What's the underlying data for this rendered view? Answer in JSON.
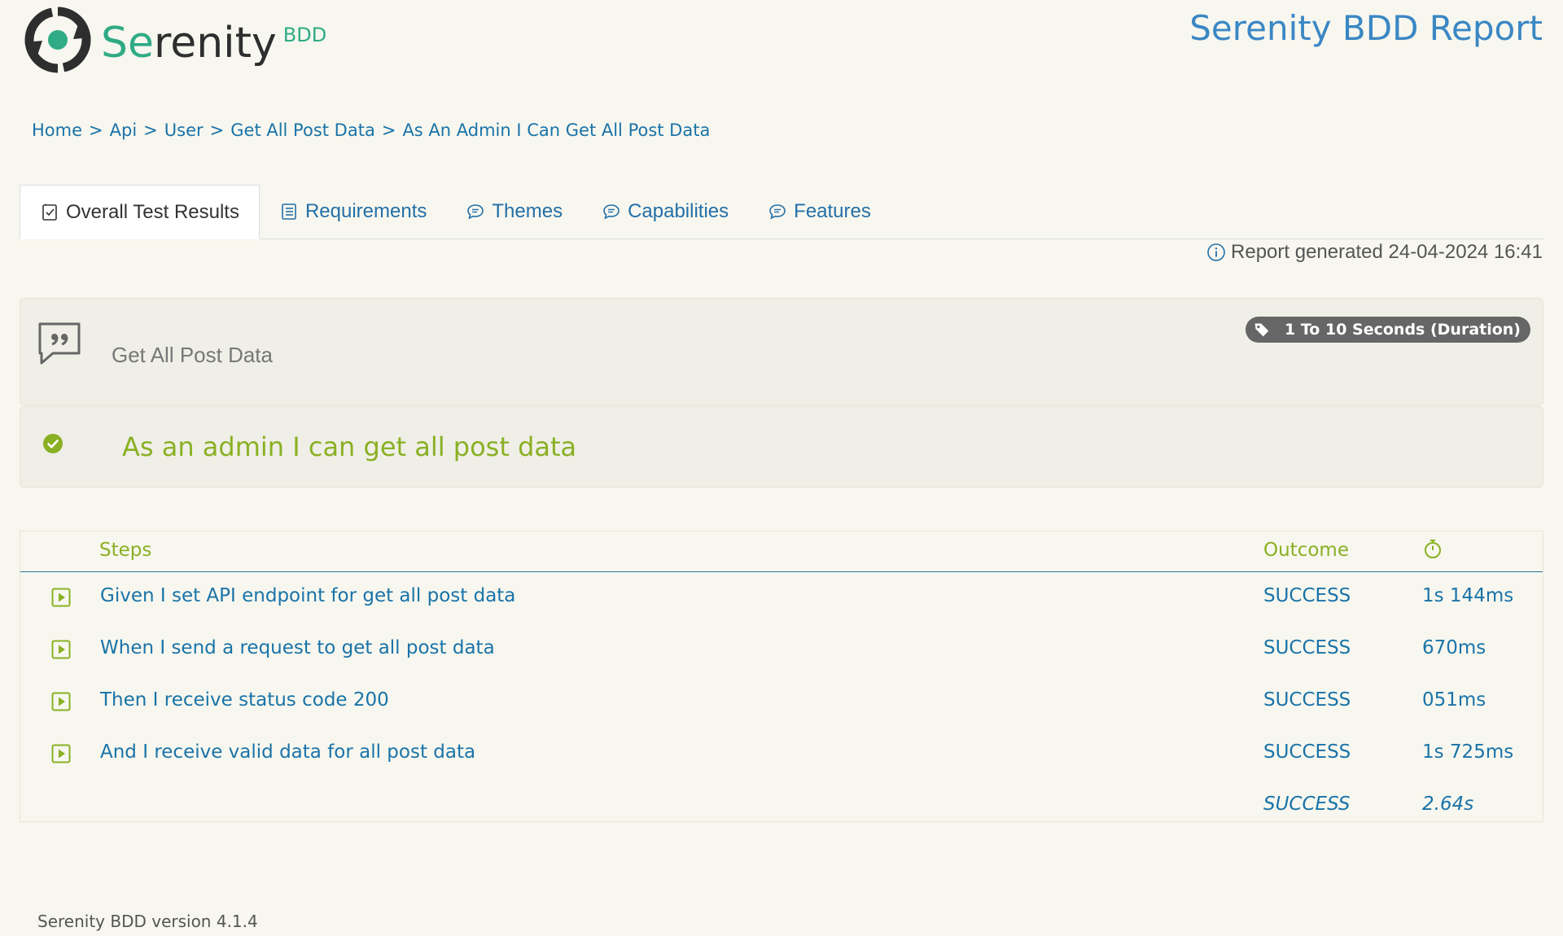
{
  "header": {
    "logo_word_prefix": "Se",
    "logo_word_rest": "renity",
    "logo_suffix": "BDD",
    "report_title": "Serenity BDD Report"
  },
  "breadcrumb": {
    "items": [
      "Home",
      "Api",
      "User",
      "Get All Post Data",
      "As An Admin I Can Get All Post Data"
    ],
    "separator": ">"
  },
  "tabs": [
    {
      "label": "Overall Test Results",
      "icon": "checklist-icon",
      "active": true
    },
    {
      "label": "Requirements",
      "icon": "list-icon",
      "active": false
    },
    {
      "label": "Themes",
      "icon": "comment-icon",
      "active": false
    },
    {
      "label": "Capabilities",
      "icon": "comment-icon",
      "active": false
    },
    {
      "label": "Features",
      "icon": "comment-icon",
      "active": false
    }
  ],
  "report_generated": "Report generated 24-04-2024 16:41",
  "feature": {
    "title": "Get All Post Data",
    "tag": "1 To 10 Seconds (Duration)"
  },
  "scenario": {
    "title": "As an admin I can get all post data",
    "status_icon": "check-circle-icon"
  },
  "steps_table": {
    "headers": {
      "steps": "Steps",
      "outcome": "Outcome",
      "time_icon": "stopwatch-icon"
    },
    "rows": [
      {
        "step": "Given I set API endpoint for get all post data",
        "outcome": "SUCCESS",
        "duration": "1s 144ms"
      },
      {
        "step": "When I send a request to get all post data",
        "outcome": "SUCCESS",
        "duration": "670ms"
      },
      {
        "step": "Then I receive status code 200",
        "outcome": "SUCCESS",
        "duration": "051ms"
      },
      {
        "step": "And I receive valid data for all post data",
        "outcome": "SUCCESS",
        "duration": "1s 725ms"
      }
    ],
    "total": {
      "outcome": "SUCCESS",
      "duration": "2.64s"
    }
  },
  "footer": {
    "version": "Serenity BDD version 4.1.4"
  },
  "colors": {
    "background": "#f7f7ef",
    "brand_green": "#2fab85",
    "link_blue": "#1a73a8",
    "success_green": "#8ab024",
    "title_blue": "#3b87c4"
  }
}
